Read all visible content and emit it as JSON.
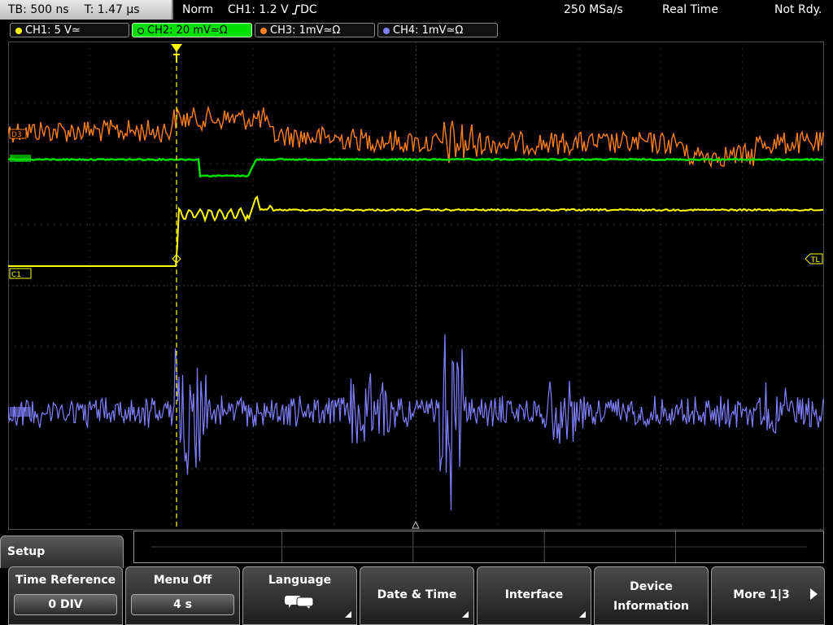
{
  "status": {
    "timebase": "TB: 500 ns",
    "trigger_time": "T: 1.47 µs",
    "mode": "Norm",
    "trigger": "CH1: 1.2 V",
    "trigger_suffix": "DC",
    "samplerate": "250 MSa/s",
    "acq_mode": "Real Time",
    "state": "Not Rdy."
  },
  "channels": [
    {
      "label": "CH1: 5 V≃",
      "color": "#ffff00"
    },
    {
      "label": "CH2: 20 mV≃Ω",
      "color": "#00e000"
    },
    {
      "label": "CH3: 1mV≃Ω",
      "color": "#ff8020"
    },
    {
      "label": "CH4: 1mV≃Ω",
      "color": "#8080ff"
    }
  ],
  "markers": {
    "c1": "C1",
    "d3": "D3",
    "tl": "TL"
  },
  "menu": {
    "title": "Setup",
    "keys": [
      {
        "label": "Time Reference",
        "value": "0 DIV"
      },
      {
        "label": "Menu Off",
        "value": "4 s"
      },
      {
        "label": "Language",
        "icon": "speech-bubbles-icon"
      },
      {
        "label": "Date & Time"
      },
      {
        "label": "Interface"
      },
      {
        "label1": "Device",
        "label2": "Information"
      },
      {
        "label": "More 1|3"
      }
    ]
  }
}
